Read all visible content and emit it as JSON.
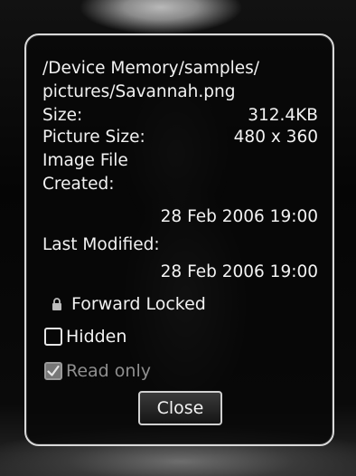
{
  "dialog": {
    "path_line1": "/Device Memory/samples/",
    "path_line2": "pictures/Savannah.png",
    "size_label": "Size:",
    "size_value": "312.4KB",
    "picture_size_label": "Picture Size:",
    "picture_size_value": "480 x 360",
    "type_label": "Image File",
    "created_label": "Created:",
    "created_value": "28 Feb 2006 19:00",
    "modified_label": "Last Modified:",
    "modified_value": "28 Feb 2006 19:00",
    "forward_locked_label": "Forward Locked",
    "hidden_label": "Hidden",
    "hidden_checked": false,
    "read_only_label": "Read only",
    "read_only_checked": true,
    "read_only_disabled": true,
    "close_label": "Close",
    "icons": {
      "lock": "lock-icon",
      "check": "check-icon"
    }
  }
}
